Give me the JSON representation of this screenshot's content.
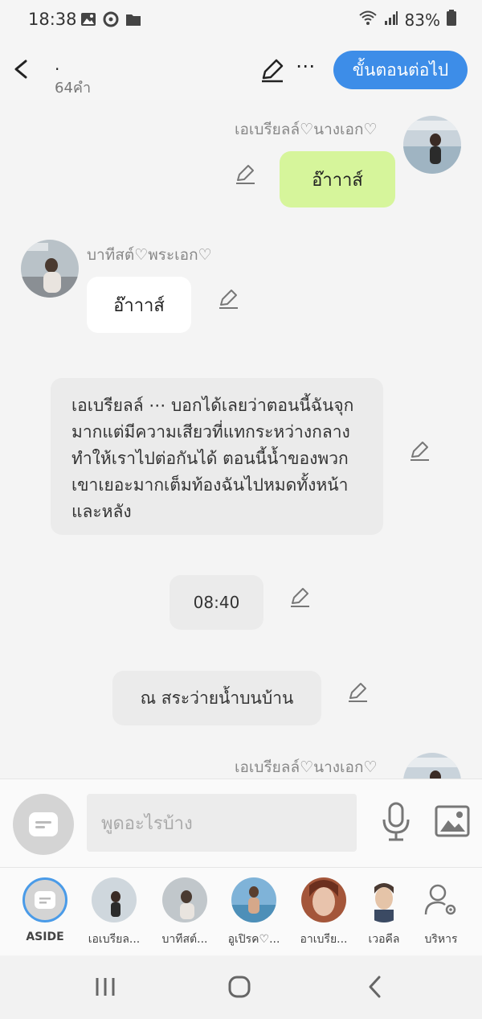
{
  "status": {
    "time": "18:38",
    "battery": "83%"
  },
  "header": {
    "title": ".",
    "word_count": "64คำ",
    "next_label": "ขั้นตอนต่อไป",
    "more": "⋯"
  },
  "messages": {
    "m1": {
      "name": "เอเบรียลล์♡นางเอก♡",
      "text": "อ๊าาาส์"
    },
    "m2": {
      "name": "บาทีสต์♡พระเอก♡",
      "text": "อ๊าาาส์"
    },
    "narration": {
      "text": "เอเบรียลล์ ⋯ บอกได้เลยว่าตอนนี้ฉันจุกมากแต่มีความเสียวที่แทกระหว่างกลาง ทำให้เราไปต่อกันได้ ตอนนี้น้ำของพวกเขาเยอะมากเต็มท้องฉันไปหมดทั้งหน้าและหลัง"
    },
    "time_note": {
      "text": "08:40"
    },
    "place_note": {
      "text": "ณ สระว่ายน้ำบนบ้าน"
    },
    "m3": {
      "name": "เอเบรียลล์♡นางเอก♡"
    }
  },
  "input": {
    "placeholder": "พูดอะไรบ้าง"
  },
  "characters": [
    {
      "label": "ASIDE"
    },
    {
      "label": "เอเบรียล..."
    },
    {
      "label": "บาทีสต์..."
    },
    {
      "label": "อูเปิรค♡..."
    },
    {
      "label": "อาเบรีย..."
    },
    {
      "label": "เวอคีล"
    },
    {
      "label": "บริหาร"
    }
  ],
  "colors": {
    "accent": "#3d8de8",
    "my_bubble": "#d6f59b",
    "other_bubble": "#ffffff"
  }
}
